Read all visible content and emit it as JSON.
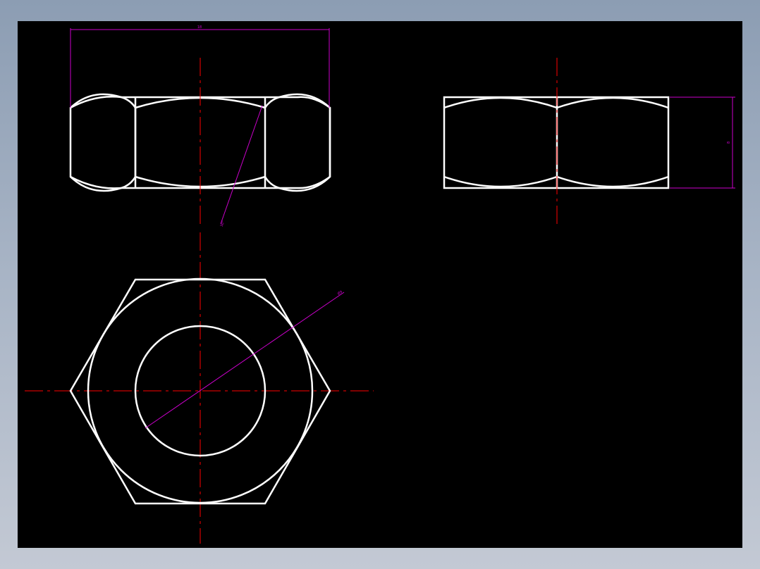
{
  "colors": {
    "frame_gradient_top": "#8c9db3",
    "frame_gradient_bottom": "#c3c9d4",
    "canvas_background": "#000000",
    "geometry": "#ffffff",
    "centerline": "#ff0000",
    "dimension": "#cc00cc"
  },
  "dimensions": {
    "top_width_label": "18",
    "chamfer_angle_label": "30°",
    "height_label": "8",
    "diameter_label": "Ø9"
  }
}
